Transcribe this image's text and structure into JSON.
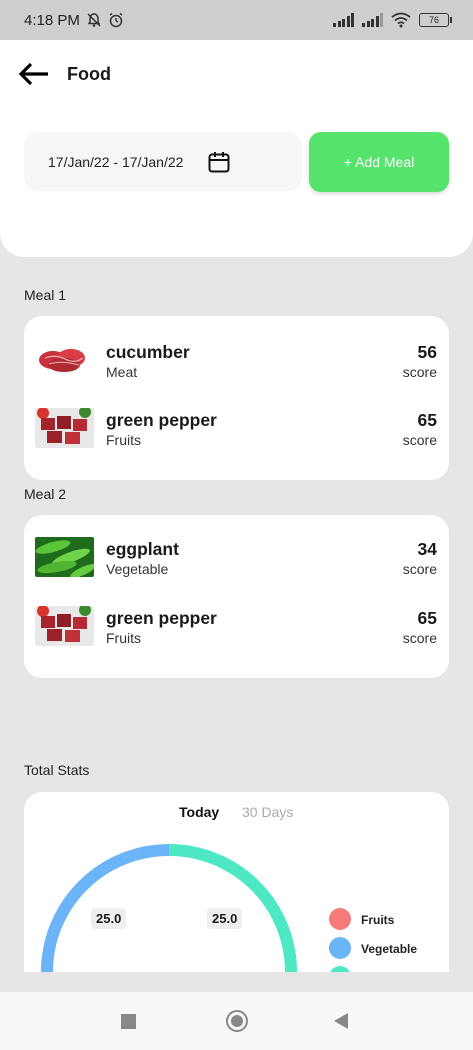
{
  "status_bar": {
    "time": "4:18 PM",
    "battery": "76"
  },
  "header": {
    "title": "Food"
  },
  "date_range": "17/Jan/22 - 17/Jan/22",
  "add_meal_label": "+ Add Meal",
  "meals": [
    {
      "label": "Meal 1",
      "items": [
        {
          "name": "cucumber",
          "category": "Meat",
          "score": "56",
          "score_label": "score",
          "image": "meat-photo"
        },
        {
          "name": "green pepper",
          "category": "Fruits",
          "score": "65",
          "score_label": "score",
          "image": "beef-cubes-photo"
        }
      ]
    },
    {
      "label": "Meal 2",
      "items": [
        {
          "name": "eggplant",
          "category": "Vegetable",
          "score": "34",
          "score_label": "score",
          "image": "green-peas-photo"
        },
        {
          "name": "green pepper",
          "category": "Fruits",
          "score": "65",
          "score_label": "score",
          "image": "beef-cubes-photo"
        }
      ]
    }
  ],
  "stats": {
    "label": "Total Stats",
    "tabs": {
      "today": "Today",
      "days30": "30 Days"
    },
    "legend": [
      {
        "name": "Fruits",
        "color": "#f77a7a"
      },
      {
        "name": "Vegetable",
        "color": "#6ab4f7"
      },
      {
        "name": "",
        "color": "#4ee8c4"
      }
    ]
  },
  "chart_data": {
    "type": "pie",
    "slices": [
      {
        "label": "Vegetable",
        "value": 25.0,
        "color": "#6ab4f7"
      },
      {
        "label": "",
        "value": 25.0,
        "color": "#4ee8c4"
      }
    ],
    "data_labels": [
      "25.0",
      "25.0"
    ]
  }
}
